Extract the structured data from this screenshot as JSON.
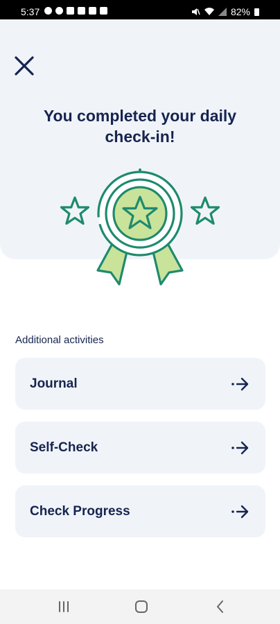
{
  "status_bar": {
    "time": "5:37",
    "battery": "82%"
  },
  "header": {
    "close_icon": "close-icon"
  },
  "hero": {
    "title": "You completed your daily check-in!",
    "badge_icon": "award-badge-icon",
    "colors": {
      "green_dark": "#1e8a6e",
      "green_light": "#c9e39a"
    }
  },
  "activities": {
    "section_label": "Additional activities",
    "items": [
      {
        "label": "Journal",
        "icon": "arrow-right-icon"
      },
      {
        "label": "Self-Check",
        "icon": "arrow-right-icon"
      },
      {
        "label": "Check Progress",
        "icon": "arrow-right-icon"
      }
    ]
  },
  "nav_bar": {
    "recents_icon": "recents-icon",
    "home_icon": "home-icon",
    "back_icon": "back-icon"
  },
  "colors": {
    "text_primary": "#16244f",
    "card_background": "#f0f4f9",
    "accent_green": "#1e8a6e"
  }
}
